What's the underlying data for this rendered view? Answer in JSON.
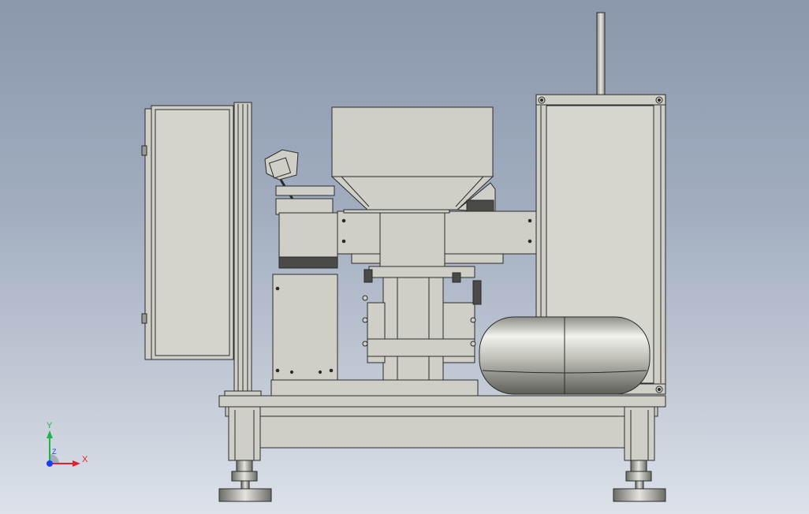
{
  "viewport": {
    "background_top": "#8a97ac",
    "background_bottom": "#dde2e9"
  },
  "colors": {
    "part_fill": "#cfcfc8",
    "part_shade": "#b9b9b2",
    "edge": "#2b2b2b",
    "dark_slot": "#4a4a48",
    "axis_x": "#e0202a",
    "axis_y": "#1fb34a",
    "axis_z": "#1a3cff"
  },
  "triad": {
    "x_label": "X",
    "y_label": "Y",
    "z_label": "Z"
  }
}
